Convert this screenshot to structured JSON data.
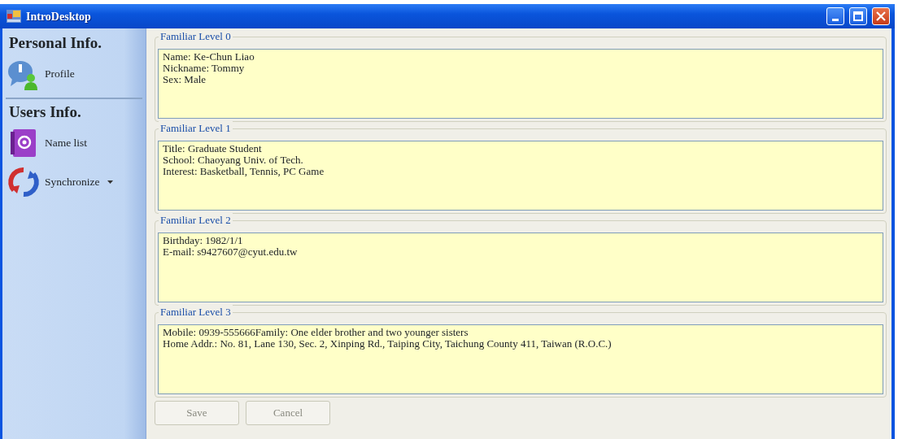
{
  "window": {
    "title": "IntroDesktop"
  },
  "sidebar": {
    "sections": [
      {
        "heading": "Personal Info.",
        "items": [
          {
            "label": "Profile",
            "kind": "profile",
            "dropdown": false
          }
        ]
      },
      {
        "heading": "Users Info.",
        "items": [
          {
            "label": "Name list",
            "kind": "addressbook",
            "dropdown": false
          },
          {
            "label": "Synchronize",
            "kind": "sync",
            "dropdown": true
          }
        ]
      }
    ]
  },
  "groups": [
    {
      "title": "Familiar Level 0",
      "lines": [
        "Name: Ke-Chun Liao",
        "Nickname: Tommy",
        "Sex: Male"
      ]
    },
    {
      "title": "Familiar Level 1",
      "lines": [
        "Title: Graduate Student",
        "School: Chaoyang Univ. of Tech.",
        "Interest: Basketball, Tennis, PC Game"
      ]
    },
    {
      "title": "Familiar Level 2",
      "lines": [
        "Birthday: 1982/1/1",
        "E-mail: s9427607@cyut.edu.tw"
      ]
    },
    {
      "title": "Familiar Level 3",
      "lines": [
        "Mobile: 0939-555666Family: One elder brother and two younger sisters",
        "Home Addr.: No. 81, Lane 130, Sec. 2, Xinping Rd., Taiping City, Taichung County 411, Taiwan (R.O.C.)"
      ]
    }
  ],
  "buttons": [
    {
      "label": "Save",
      "disabled": true
    },
    {
      "label": "Cancel",
      "disabled": true
    }
  ]
}
